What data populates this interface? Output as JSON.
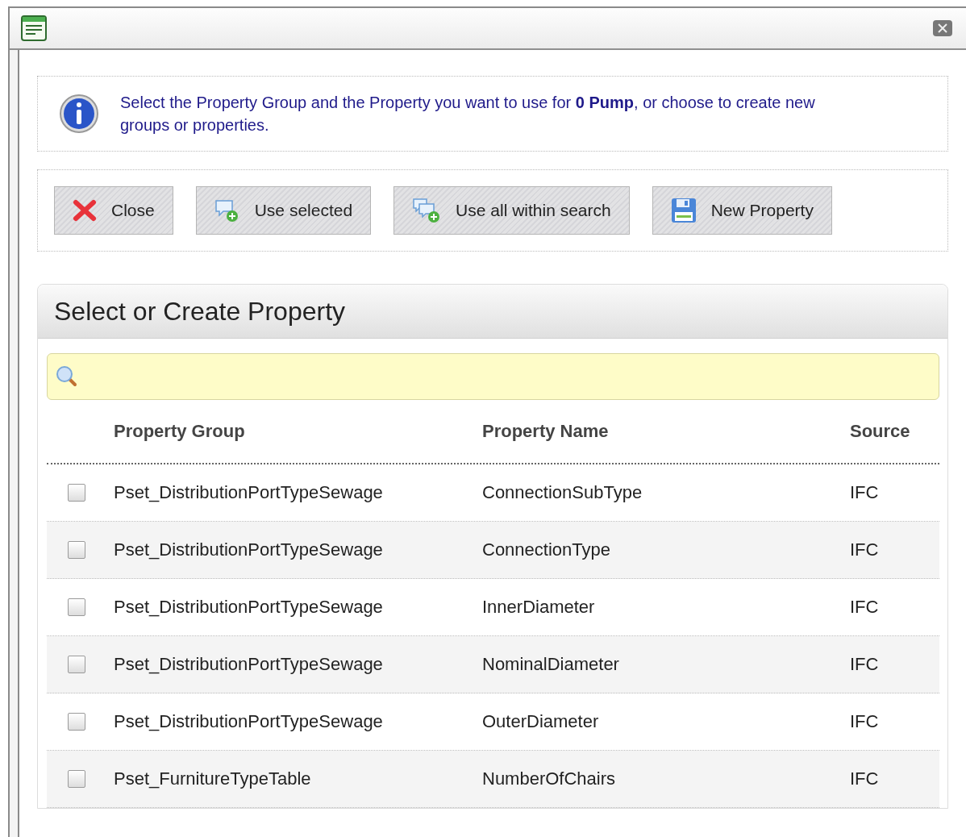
{
  "info": {
    "message": "Select the Property Group and the Property you want to use for **0 Pump**, or choose to create new groups or properties."
  },
  "toolbar": [
    {
      "label": "Close",
      "kind": "close"
    },
    {
      "label": "Use selected",
      "kind": "use"
    },
    {
      "label": "Use all within search",
      "kind": "useall"
    },
    {
      "label": "New Property",
      "kind": "save"
    }
  ],
  "panel": {
    "title": "Select or Create Property"
  },
  "table": {
    "columns": [
      "Property Group",
      "Property Name",
      "Source"
    ],
    "rows": [
      {
        "checked": false,
        "cells": [
          "Pset_DistributionPortTypeSewage",
          "ConnectionSubType",
          "IFC"
        ]
      },
      {
        "checked": false,
        "cells": [
          "Pset_DistributionPortTypeSewage",
          "ConnectionType",
          "IFC"
        ]
      },
      {
        "checked": false,
        "cells": [
          "Pset_DistributionPortTypeSewage",
          "InnerDiameter",
          "IFC"
        ]
      },
      {
        "checked": false,
        "cells": [
          "Pset_DistributionPortTypeSewage",
          "NominalDiameter",
          "IFC"
        ]
      },
      {
        "checked": false,
        "cells": [
          "Pset_DistributionPortTypeSewage",
          "OuterDiameter",
          "IFC"
        ]
      },
      {
        "checked": false,
        "cells": [
          "Pset_FurnitureTypeTable",
          "NumberOfChairs",
          "IFC"
        ]
      }
    ]
  }
}
